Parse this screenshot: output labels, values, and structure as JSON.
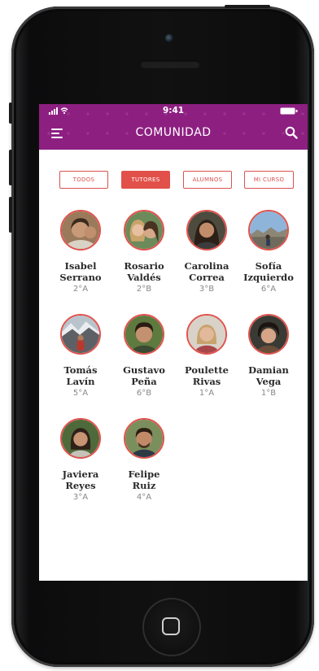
{
  "status_bar": {
    "time": "9:41"
  },
  "header": {
    "title": "COMUNIDAD",
    "accent": "#8d1f81"
  },
  "filters": [
    {
      "label": "TODOS",
      "active": false
    },
    {
      "label": "TUTORES",
      "active": true
    },
    {
      "label": "ALUMNOS",
      "active": false
    },
    {
      "label": "MI CURSO",
      "active": false
    }
  ],
  "people": [
    {
      "first": "Isabel",
      "last": "Serrano",
      "grade": "2°A"
    },
    {
      "first": "Rosario",
      "last": "Valdés",
      "grade": "2°B"
    },
    {
      "first": "Carolina",
      "last": "Correa",
      "grade": "3°B"
    },
    {
      "first": "Sofía",
      "last": "Izquierdo",
      "grade": "6°A"
    },
    {
      "first": "Tomás",
      "last": "Lavín",
      "grade": "5°A"
    },
    {
      "first": "Gustavo",
      "last": "Peña",
      "grade": "6°B"
    },
    {
      "first": "Poulette",
      "last": "Rivas",
      "grade": "1°A"
    },
    {
      "first": "Damian",
      "last": "Vega",
      "grade": "1°B"
    },
    {
      "first": "Javiera",
      "last": "Reyes",
      "grade": "3°A"
    },
    {
      "first": "Felipe",
      "last": "Ruiz",
      "grade": "4°A"
    }
  ],
  "colors": {
    "accent_red": "#e2504a",
    "header_purple": "#8d1f81"
  }
}
